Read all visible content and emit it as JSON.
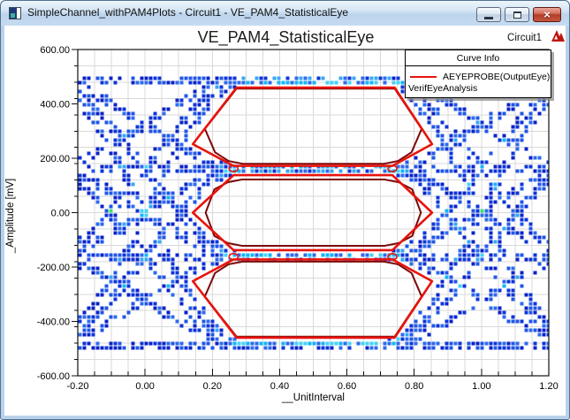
{
  "window": {
    "title": "SimpleChannel_withPAM4Plots - Circuit1 - VE_PAM4_StatisticalEye",
    "icons": {
      "minimize_glyph": "",
      "maximize_glyph": "",
      "close_glyph": "×"
    }
  },
  "header": {
    "plot_title": "VE_PAM4_StatisticalEye",
    "design_label": "Circuit1",
    "logo_color": "#c0160f"
  },
  "legend": {
    "title": "Curve Info",
    "entries": [
      {
        "swatch_color": "#e8140e",
        "label": "AEYEPROBE(OutputEye)",
        "sublabel": "VerifEyeAnalysis"
      }
    ]
  },
  "axes": {
    "x": {
      "label": "__UnitInterval",
      "min": -0.2,
      "max": 1.2,
      "major_step": 0.2,
      "minor_step": 0.05,
      "tick_labels": [
        "-0.20",
        "0.00",
        "0.20",
        "0.40",
        "0.60",
        "0.80",
        "1.00",
        "1.20"
      ]
    },
    "y": {
      "label": "_Amplitude [mV]",
      "min": -600,
      "max": 600,
      "major_step": 200,
      "minor_step": 60,
      "tick_labels": [
        "600.00",
        "400.00",
        "200.00",
        "0.00",
        "-200.00",
        "-400.00",
        "-600.00"
      ]
    }
  },
  "chart_data": {
    "type": "heatmap",
    "title": "VE_PAM4_StatisticalEye",
    "xlabel": "__UnitInterval",
    "ylabel": "_Amplitude [mV]",
    "xlim": [
      -0.2,
      1.2
    ],
    "ylim": [
      -600,
      600
    ],
    "grid": true,
    "legend_position": "top-right",
    "pam4_levels_mv": [
      485,
      162,
      -162,
      -485
    ],
    "transition_centers_ui": [
      0.0,
      1.0
    ],
    "transition_half_width_ui": 0.3,
    "eye_openings_ui": [
      0.142,
      0.853
    ],
    "contour_color": "#e8140e",
    "inner_contour_color": "#7c0a0a",
    "density_palette": [
      "#0a23c8",
      "#0d35db",
      "#2057e8",
      "#2e6bee",
      "#35a8f5",
      "#12b6f7",
      "#43d3fb",
      "#28c9f8",
      "#3ae36e",
      "#b9ef3a",
      "#f6f65e",
      "#ffffff"
    ],
    "eye_contours_red": [
      [
        [
          0.142,
          252
        ],
        [
          0.272,
          460
        ],
        [
          0.742,
          460
        ],
        [
          0.853,
          252
        ],
        [
          0.735,
          172
        ],
        [
          0.263,
          172
        ]
      ],
      [
        [
          0.142,
          0
        ],
        [
          0.263,
          138
        ],
        [
          0.735,
          138
        ],
        [
          0.853,
          0
        ],
        [
          0.735,
          -138
        ],
        [
          0.263,
          -138
        ]
      ],
      [
        [
          0.142,
          -252
        ],
        [
          0.263,
          -172
        ],
        [
          0.735,
          -172
        ],
        [
          0.853,
          -252
        ],
        [
          0.742,
          -460
        ],
        [
          0.272,
          -460
        ]
      ]
    ],
    "eye_contours_inner_maroon": [
      [
        [
          0.178,
          308
        ],
        [
          0.208,
          222
        ],
        [
          0.248,
          190
        ],
        [
          0.29,
          180
        ],
        [
          0.71,
          180
        ],
        [
          0.752,
          190
        ],
        [
          0.792,
          222
        ],
        [
          0.822,
          308
        ],
        [
          0.742,
          456
        ],
        [
          0.272,
          456
        ]
      ],
      [
        [
          0.18,
          0
        ],
        [
          0.206,
          86
        ],
        [
          0.246,
          112
        ],
        [
          0.288,
          122
        ],
        [
          0.712,
          122
        ],
        [
          0.754,
          112
        ],
        [
          0.794,
          86
        ],
        [
          0.82,
          0
        ],
        [
          0.794,
          -86
        ],
        [
          0.754,
          -112
        ],
        [
          0.712,
          -122
        ],
        [
          0.288,
          -122
        ],
        [
          0.246,
          -112
        ],
        [
          0.206,
          -86
        ]
      ],
      [
        [
          0.178,
          -308
        ],
        [
          0.208,
          -222
        ],
        [
          0.248,
          -190
        ],
        [
          0.29,
          -180
        ],
        [
          0.71,
          -180
        ],
        [
          0.752,
          -190
        ],
        [
          0.792,
          -222
        ],
        [
          0.822,
          -308
        ],
        [
          0.742,
          -456
        ],
        [
          0.272,
          -456
        ]
      ]
    ],
    "pinch_points": [
      [
        0.263,
        162
      ],
      [
        0.735,
        162
      ],
      [
        0.263,
        -162
      ],
      [
        0.735,
        -162
      ]
    ]
  }
}
